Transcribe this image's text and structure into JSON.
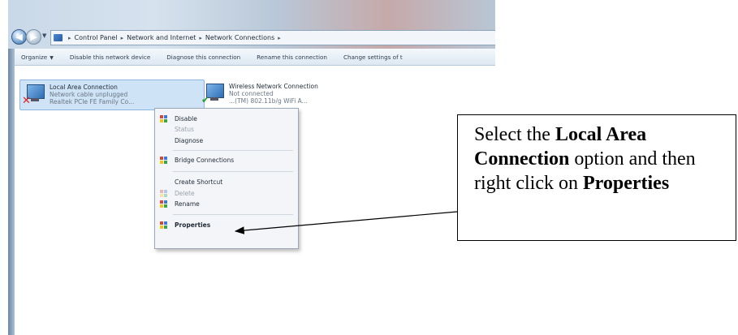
{
  "address_bar": {
    "crumbs": [
      "Control Panel",
      "Network and Internet",
      "Network Connections"
    ]
  },
  "toolbar": {
    "items": [
      "Organize",
      "Disable this network device",
      "Diagnose this connection",
      "Rename this connection",
      "Change settings of t"
    ]
  },
  "connections": [
    {
      "name": "Local Area Connection",
      "status": "Network cable unplugged",
      "device": "Realtek PCIe FE Family Co..."
    },
    {
      "name": "Wireless Network Connection",
      "status": "Not connected",
      "device": "...(TM) 802.11b/g WiFi A..."
    }
  ],
  "context_menu": {
    "items": [
      {
        "label": "Disable",
        "state": "enabled",
        "icon": "shield-icon"
      },
      {
        "label": "Status",
        "state": "disabled"
      },
      {
        "label": "Diagnose",
        "state": "enabled"
      },
      {
        "label": "Bridge Connections",
        "state": "enabled",
        "icon": "shield-icon"
      },
      {
        "label": "Create Shortcut",
        "state": "enabled"
      },
      {
        "label": "Delete",
        "state": "disabled",
        "icon": "shield-icon"
      },
      {
        "label": "Rename",
        "state": "enabled",
        "icon": "shield-icon"
      },
      {
        "label": "Properties",
        "state": "default",
        "icon": "shield-icon"
      }
    ]
  },
  "callout": {
    "part1": "Select the ",
    "bold1": "Local Area Connection",
    "part2": " option and then right click on ",
    "bold2": "Properties"
  },
  "colors": {
    "selection": "#cfe3f7",
    "error_mark": "#dd2222",
    "ok_mark": "#2a9a2a"
  }
}
